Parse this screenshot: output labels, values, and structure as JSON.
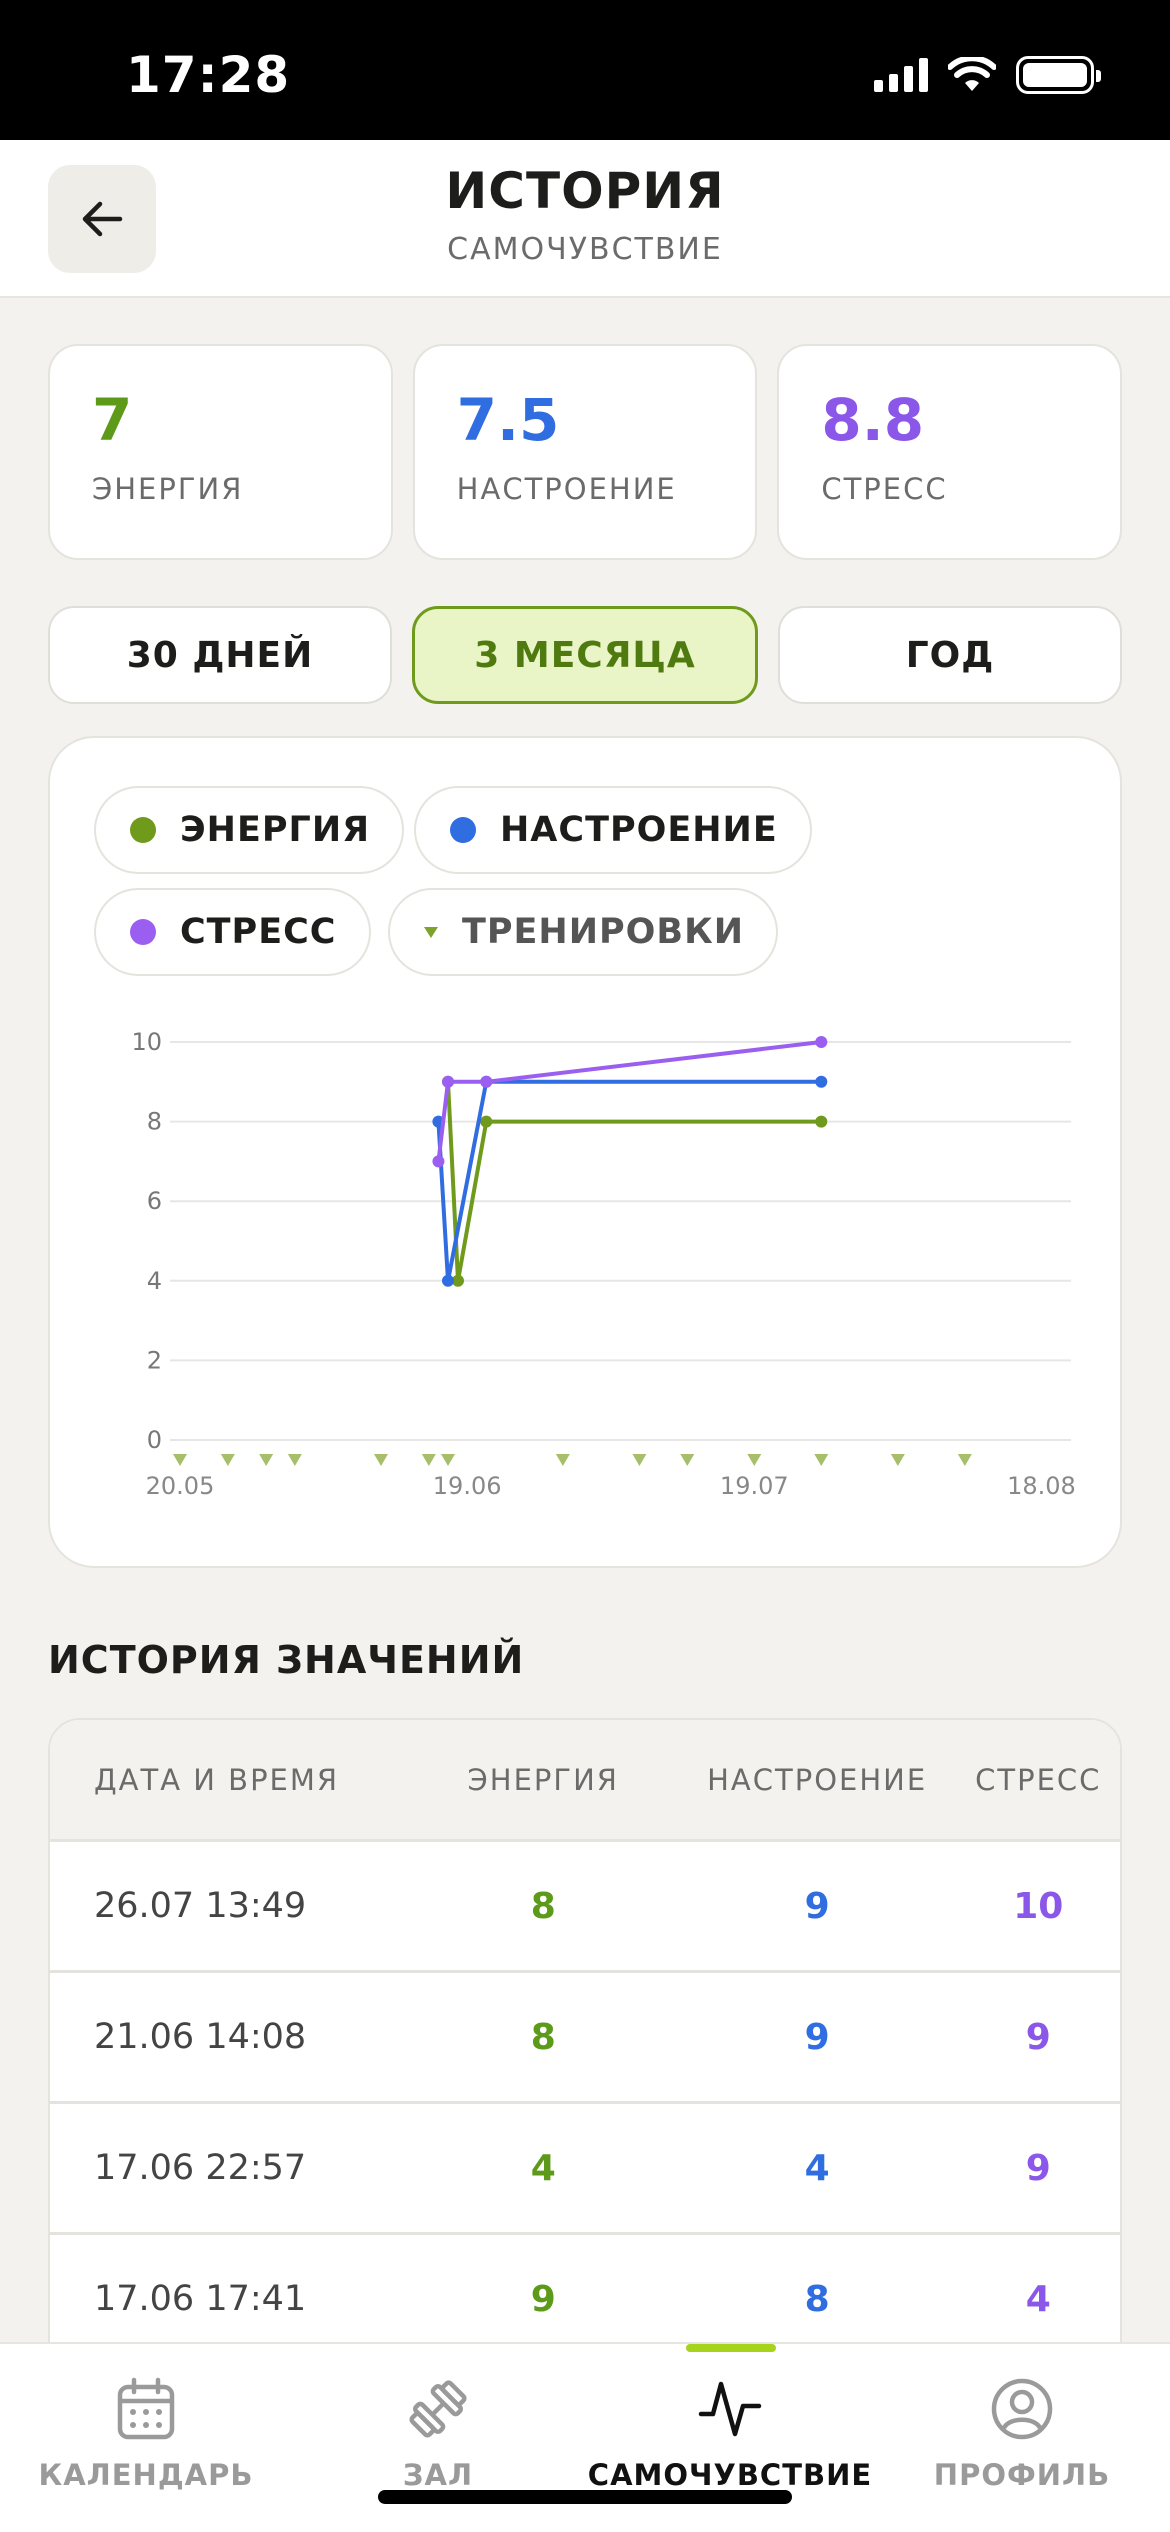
{
  "status_bar": {
    "time": "17:28"
  },
  "header": {
    "title": "ИСТОРИЯ",
    "subtitle": "САМОЧУВСТВИЕ"
  },
  "stats": [
    {
      "value": "7",
      "label": "ЭНЕРГИЯ",
      "color": "#5e9a1a"
    },
    {
      "value": "7.5",
      "label": "НАСТРОЕНИЕ",
      "color": "#2f6de0"
    },
    {
      "value": "8.8",
      "label": "СТРЕСС",
      "color": "#8b57e8"
    }
  ],
  "periods": [
    {
      "label": "30 ДНЕЙ",
      "active": false
    },
    {
      "label": "3 МЕСЯЦА",
      "active": true
    },
    {
      "label": "ГОД",
      "active": false
    }
  ],
  "legend": [
    {
      "label": "ЭНЕРГИЯ",
      "color": "#6f9a1c"
    },
    {
      "label": "НАСТРОЕНИЕ",
      "color": "#2f6de0"
    },
    {
      "label": "СТРЕСС",
      "color": "#9a5ff0"
    },
    {
      "label": "ТРЕНИРОВКИ",
      "color": "#7ea22a"
    }
  ],
  "chart_data": {
    "type": "line",
    "x_start": "20.05",
    "x_end": "19.08",
    "x_ticks": [
      "20.05",
      "19.06",
      "19.07",
      "18.08"
    ],
    "y_ticks": [
      0,
      2,
      4,
      6,
      8,
      10
    ],
    "ylim": [
      0,
      10
    ],
    "grid": true,
    "series": [
      {
        "name": "ЭНЕРГИЯ",
        "color": "#6f9a1c",
        "points": [
          [
            "17.06",
            9
          ],
          [
            "17.06",
            4
          ],
          [
            "21.06",
            8
          ],
          [
            "26.07",
            8
          ]
        ]
      },
      {
        "name": "НАСТРОЕНИЕ",
        "color": "#2f6de0",
        "points": [
          [
            "16.06",
            8
          ],
          [
            "17.06",
            4
          ],
          [
            "21.06",
            9
          ],
          [
            "26.07",
            9
          ]
        ]
      },
      {
        "name": "СТРЕСС",
        "color": "#9a5ff0",
        "points": [
          [
            "16.06",
            7
          ],
          [
            "17.06",
            9
          ],
          [
            "21.06",
            9
          ],
          [
            "26.07",
            10
          ]
        ]
      }
    ],
    "trainings": [
      "20.05",
      "25.05",
      "29.05",
      "01.06",
      "10.06",
      "15.06",
      "17.06",
      "29.06",
      "07.07",
      "12.07",
      "19.07",
      "26.07",
      "03.08",
      "10.08"
    ]
  },
  "history": {
    "title": "ИСТОРИЯ ЗНАЧЕНИЙ",
    "headers": [
      "ДАТА И ВРЕМЯ",
      "ЭНЕРГИЯ",
      "НАСТРОЕНИЕ",
      "СТРЕСС"
    ],
    "rows": [
      {
        "date": "26.07 13:49",
        "energy": "8",
        "mood": "9",
        "stress": "10"
      },
      {
        "date": "21.06 14:08",
        "energy": "8",
        "mood": "9",
        "stress": "9"
      },
      {
        "date": "17.06 22:57",
        "energy": "4",
        "mood": "4",
        "stress": "9"
      },
      {
        "date": "17.06 17:41",
        "energy": "9",
        "mood": "8",
        "stress": "4"
      }
    ]
  },
  "tabbar": [
    {
      "label": "КАЛЕНДАРЬ",
      "icon": "calendar-icon",
      "active": false
    },
    {
      "label": "ЗАЛ",
      "icon": "dumbbell-icon",
      "active": false
    },
    {
      "label": "САМОЧУВСТВИЕ",
      "icon": "pulse-icon",
      "active": true
    },
    {
      "label": "ПРОФИЛЬ",
      "icon": "profile-icon",
      "active": false
    }
  ]
}
